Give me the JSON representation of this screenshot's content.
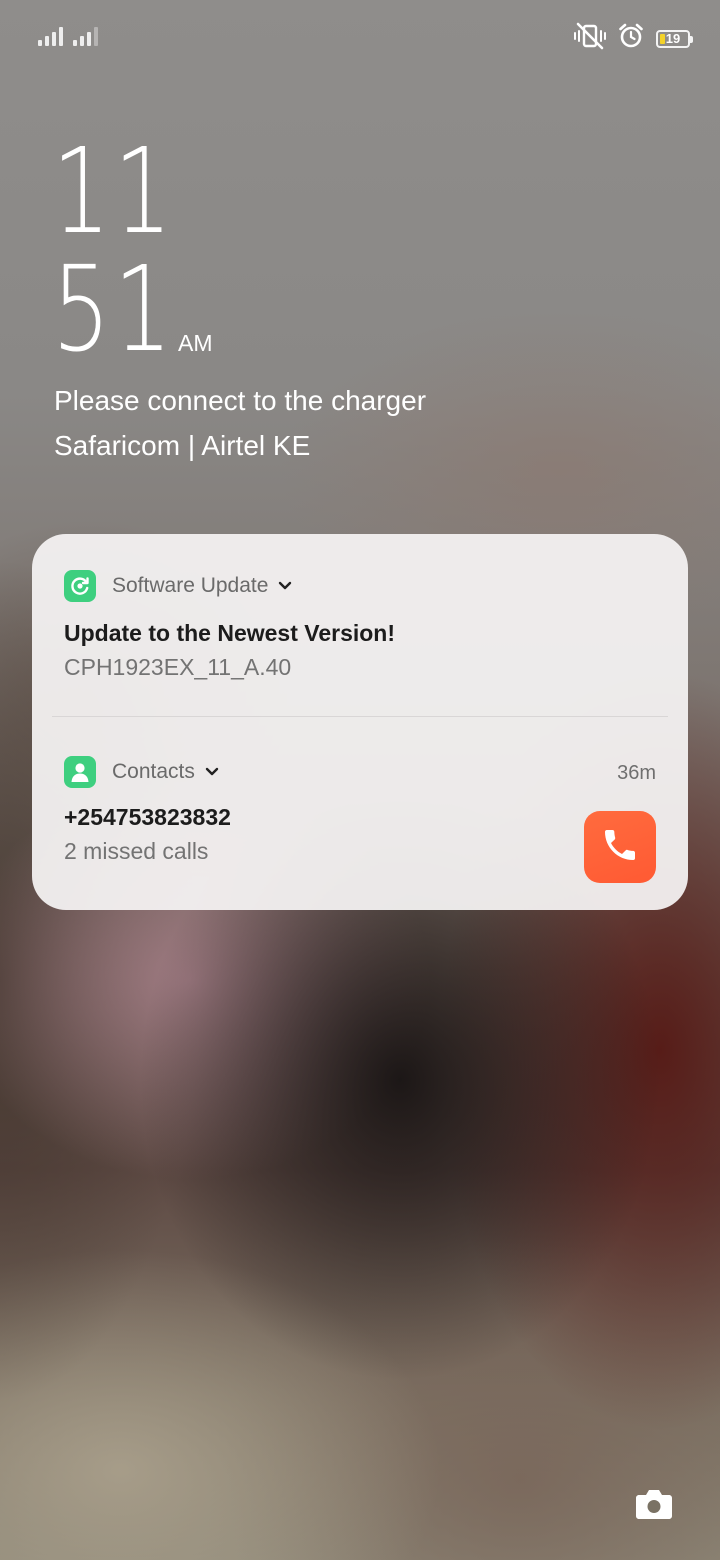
{
  "status_bar": {
    "sim1_signal_icon": "signal-bars-icon",
    "sim2_signal_icon": "signal-bars-icon",
    "mute_vibrate_icon": "vibrate-mute-icon",
    "alarm_icon": "alarm-clock-icon",
    "battery_level": "19",
    "battery_fill_percent": 19,
    "battery_accent": "#f4d32a"
  },
  "clock": {
    "hour": "11",
    "minute": "51",
    "ampm": "AM"
  },
  "lock_info": {
    "charging_message": "Please connect to the charger",
    "carriers": "Safaricom | Airtel KE"
  },
  "notifications": [
    {
      "app": "Software Update",
      "app_icon": "software-update-icon",
      "title": "Update to the Newest Version!",
      "body": "CPH1923EX_11_A.40"
    },
    {
      "app": "Contacts",
      "app_icon": "contacts-icon",
      "time": "36m",
      "title": "+254753823832",
      "body": "2 missed calls",
      "action_icon": "phone-icon",
      "action_color": "#ff5f37"
    }
  ],
  "camera_shortcut_icon": "camera-icon",
  "colors": {
    "notification_app_icon": "#3ecf7f",
    "card_background": "#f4f2f2"
  }
}
